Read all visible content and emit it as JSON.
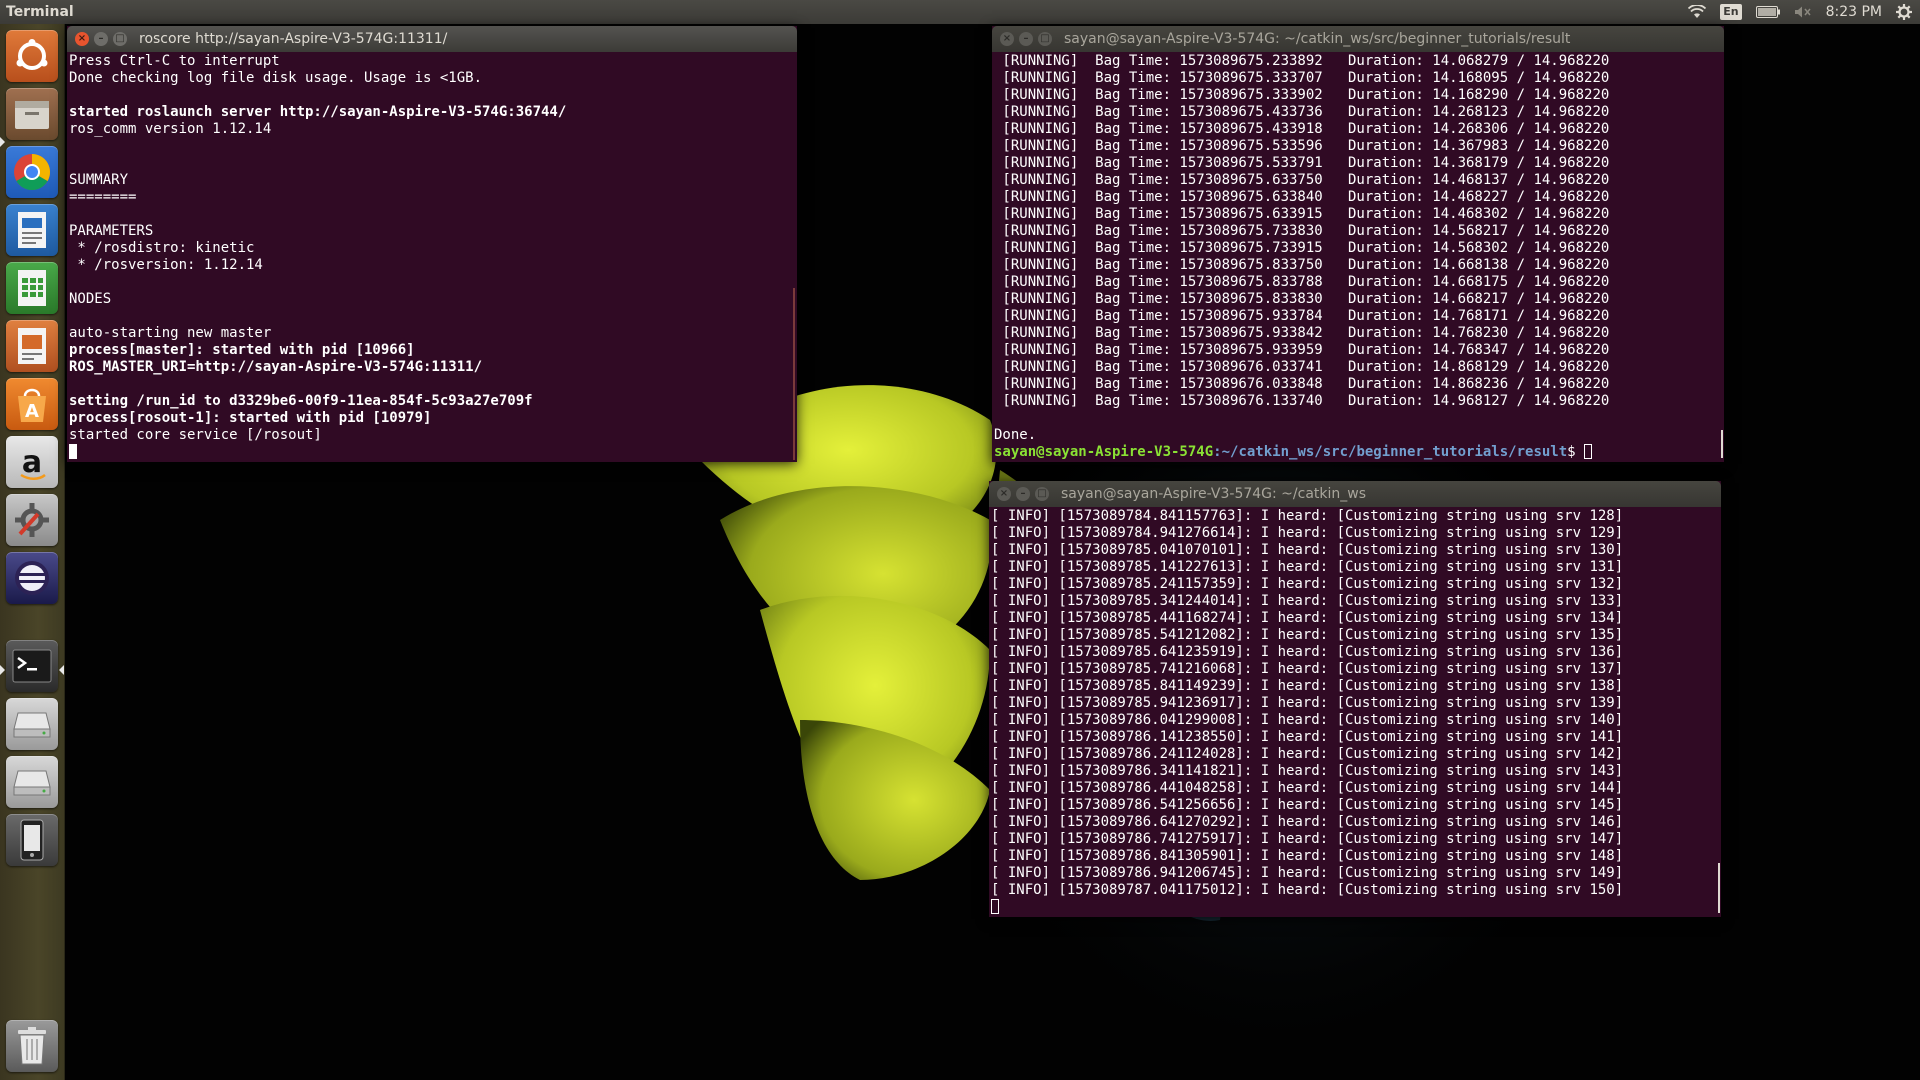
{
  "top_panel": {
    "app_title": "Terminal",
    "keyboard_layout": "En",
    "clock": "8:23 PM",
    "icons": [
      "wifi-icon",
      "keyboard-layout-indicator",
      "battery-icon",
      "volume-muted-icon",
      "settings-gear-icon"
    ]
  },
  "launcher": {
    "items": [
      {
        "name": "dash-home-icon",
        "color": "#c8622c"
      },
      {
        "name": "files-icon",
        "color": "#8a6a4a"
      },
      {
        "name": "chrome-icon",
        "color": "#2f6fd8"
      },
      {
        "name": "libreoffice-writer-icon",
        "color": "#2a6fbf"
      },
      {
        "name": "libreoffice-calc-icon",
        "color": "#3a9a3a"
      },
      {
        "name": "libreoffice-impress-icon",
        "color": "#c8622c"
      },
      {
        "name": "software-center-icon",
        "color": "#e06a1a"
      },
      {
        "name": "amazon-icon",
        "color": "#d0d0d0"
      },
      {
        "name": "system-settings-icon",
        "color": "#b0b0b0"
      },
      {
        "name": "eclipse-icon",
        "color": "#2a2a5a"
      },
      {
        "name": "terminal-icon",
        "color": "#3a3a3a"
      },
      {
        "name": "drive-icon",
        "color": "#bfbfbf"
      },
      {
        "name": "drive-icon-2",
        "color": "#bfbfbf"
      },
      {
        "name": "phone-device-icon",
        "color": "#555555"
      },
      {
        "name": "trash-icon",
        "color": "#888888"
      }
    ]
  },
  "windows": {
    "roscore": {
      "title": "roscore http://sayan-Aspire-V3-574G:11311/",
      "lines": [
        {
          "text": "Press Ctrl-C to interrupt",
          "bold": false
        },
        {
          "text": "Done checking log file disk usage. Usage is <1GB.",
          "bold": false
        },
        {
          "text": "",
          "bold": false
        },
        {
          "text": "started roslaunch server http://sayan-Aspire-V3-574G:36744/",
          "bold": true
        },
        {
          "text": "ros_comm version 1.12.14",
          "bold": false
        },
        {
          "text": "",
          "bold": false
        },
        {
          "text": "",
          "bold": false
        },
        {
          "text": "SUMMARY",
          "bold": false
        },
        {
          "text": "========",
          "bold": false
        },
        {
          "text": "",
          "bold": false
        },
        {
          "text": "PARAMETERS",
          "bold": false
        },
        {
          "text": " * /rosdistro: kinetic",
          "bold": false
        },
        {
          "text": " * /rosversion: 1.12.14",
          "bold": false
        },
        {
          "text": "",
          "bold": false
        },
        {
          "text": "NODES",
          "bold": false
        },
        {
          "text": "",
          "bold": false
        },
        {
          "text": "auto-starting new master",
          "bold": false
        },
        {
          "text": "process[master]: started with pid [10966]",
          "bold": true
        },
        {
          "text": "ROS_MASTER_URI=http://sayan-Aspire-V3-574G:11311/",
          "bold": true
        },
        {
          "text": "",
          "bold": false
        },
        {
          "text": "setting /run_id to d3329be6-00f9-11ea-854f-5c93a27e709f",
          "bold": true
        },
        {
          "text": "process[rosout-1]: started with pid [10979]",
          "bold": true
        },
        {
          "text": "started core service [/rosout]",
          "bold": false
        }
      ]
    },
    "rosbag": {
      "title": "sayan@sayan-Aspire-V3-574G: ~/catkin_ws/src/beginner_tutorials/result",
      "lines": [
        " [RUNNING]  Bag Time: 1573089675.233892   Duration: 14.068279 / 14.968220",
        " [RUNNING]  Bag Time: 1573089675.333707   Duration: 14.168095 / 14.968220",
        " [RUNNING]  Bag Time: 1573089675.333902   Duration: 14.168290 / 14.968220",
        " [RUNNING]  Bag Time: 1573089675.433736   Duration: 14.268123 / 14.968220",
        " [RUNNING]  Bag Time: 1573089675.433918   Duration: 14.268306 / 14.968220",
        " [RUNNING]  Bag Time: 1573089675.533596   Duration: 14.367983 / 14.968220",
        " [RUNNING]  Bag Time: 1573089675.533791   Duration: 14.368179 / 14.968220",
        " [RUNNING]  Bag Time: 1573089675.633750   Duration: 14.468137 / 14.968220",
        " [RUNNING]  Bag Time: 1573089675.633840   Duration: 14.468227 / 14.968220",
        " [RUNNING]  Bag Time: 1573089675.633915   Duration: 14.468302 / 14.968220",
        " [RUNNING]  Bag Time: 1573089675.733830   Duration: 14.568217 / 14.968220",
        " [RUNNING]  Bag Time: 1573089675.733915   Duration: 14.568302 / 14.968220",
        " [RUNNING]  Bag Time: 1573089675.833750   Duration: 14.668138 / 14.968220",
        " [RUNNING]  Bag Time: 1573089675.833788   Duration: 14.668175 / 14.968220",
        " [RUNNING]  Bag Time: 1573089675.833830   Duration: 14.668217 / 14.968220",
        " [RUNNING]  Bag Time: 1573089675.933784   Duration: 14.768171 / 14.968220",
        " [RUNNING]  Bag Time: 1573089675.933842   Duration: 14.768230 / 14.968220",
        " [RUNNING]  Bag Time: 1573089675.933959   Duration: 14.768347 / 14.968220",
        " [RUNNING]  Bag Time: 1573089676.033741   Duration: 14.868129 / 14.968220",
        " [RUNNING]  Bag Time: 1573089676.033848   Duration: 14.868236 / 14.968220",
        " [RUNNING]  Bag Time: 1573089676.133740   Duration: 14.968127 / 14.968220",
        "",
        "Done."
      ],
      "prompt_user": "sayan@sayan-Aspire-V3-574G",
      "prompt_path": ":~/catkin_ws/src/beginner_tutorials/result",
      "prompt_symbol": "$ "
    },
    "listener": {
      "title": "sayan@sayan-Aspire-V3-574G: ~/catkin_ws",
      "lines": [
        "[ INFO] [1573089784.841157763]: I heard: [Customizing string using srv 128]",
        "[ INFO] [1573089784.941276614]: I heard: [Customizing string using srv 129]",
        "[ INFO] [1573089785.041070101]: I heard: [Customizing string using srv 130]",
        "[ INFO] [1573089785.141227613]: I heard: [Customizing string using srv 131]",
        "[ INFO] [1573089785.241157359]: I heard: [Customizing string using srv 132]",
        "[ INFO] [1573089785.341244014]: I heard: [Customizing string using srv 133]",
        "[ INFO] [1573089785.441168274]: I heard: [Customizing string using srv 134]",
        "[ INFO] [1573089785.541212082]: I heard: [Customizing string using srv 135]",
        "[ INFO] [1573089785.641235919]: I heard: [Customizing string using srv 136]",
        "[ INFO] [1573089785.741216068]: I heard: [Customizing string using srv 137]",
        "[ INFO] [1573089785.841149239]: I heard: [Customizing string using srv 138]",
        "[ INFO] [1573089785.941236917]: I heard: [Customizing string using srv 139]",
        "[ INFO] [1573089786.041299008]: I heard: [Customizing string using srv 140]",
        "[ INFO] [1573089786.141238550]: I heard: [Customizing string using srv 141]",
        "[ INFO] [1573089786.241124028]: I heard: [Customizing string using srv 142]",
        "[ INFO] [1573089786.341141821]: I heard: [Customizing string using srv 143]",
        "[ INFO] [1573089786.441048258]: I heard: [Customizing string using srv 144]",
        "[ INFO] [1573089786.541256656]: I heard: [Customizing string using srv 145]",
        "[ INFO] [1573089786.641270292]: I heard: [Customizing string using srv 146]",
        "[ INFO] [1573089786.741275917]: I heard: [Customizing string using srv 147]",
        "[ INFO] [1573089786.841305901]: I heard: [Customizing string using srv 148]",
        "[ INFO] [1573089786.941206745]: I heard: [Customizing string using srv 149]",
        "[ INFO] [1573089787.041175012]: I heard: [Customizing string using srv 150]"
      ]
    }
  },
  "colors": {
    "terminal_bg": "#300a24",
    "prompt_user": "#8ae234",
    "prompt_path": "#729fcf",
    "close_button": "#e8542e"
  }
}
